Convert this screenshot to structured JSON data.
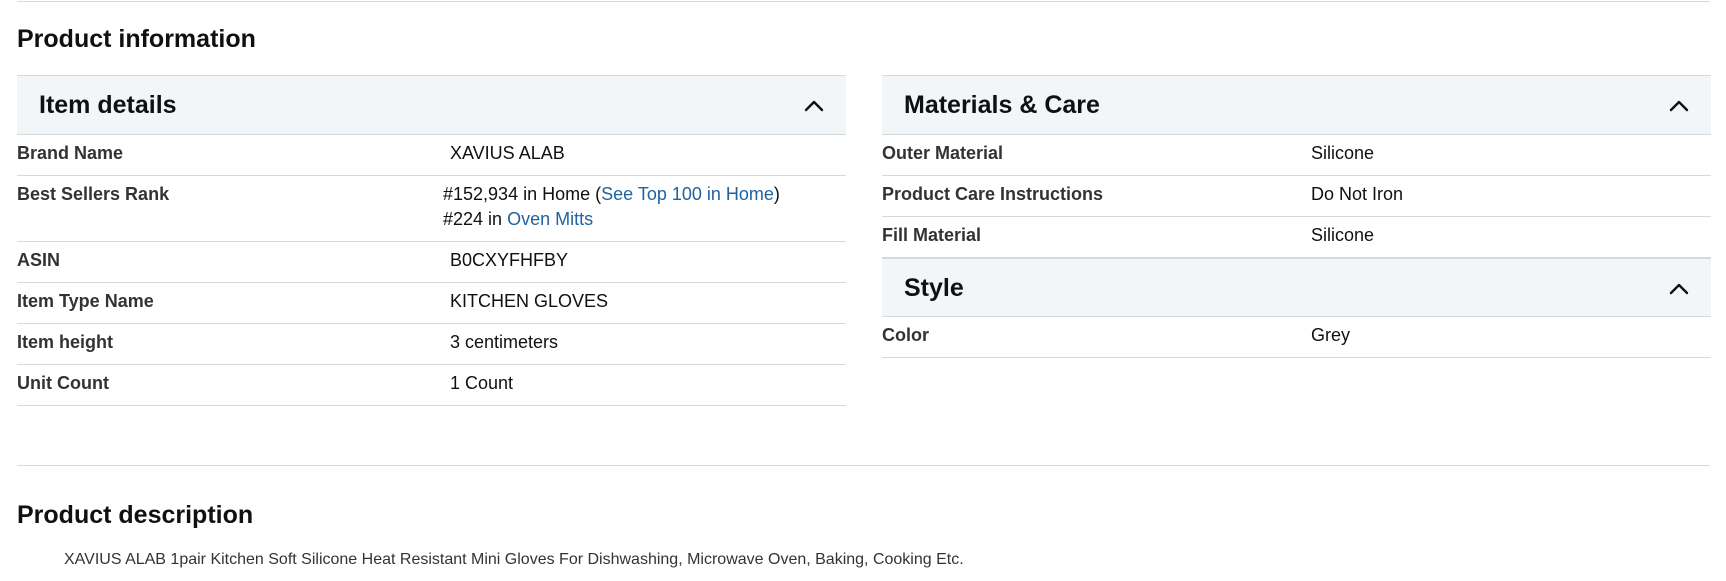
{
  "product_information": {
    "title": "Product information",
    "item_details": {
      "header": "Item details",
      "rows": [
        {
          "key": "Brand Name",
          "value": "XAVIUS ALAB"
        },
        {
          "key": "ASIN",
          "value": "B0CXYFHFBY"
        },
        {
          "key": "Item Type Name",
          "value": "KITCHEN GLOVES"
        },
        {
          "key": "Item height",
          "value": "3 centimeters"
        },
        {
          "key": "Unit Count",
          "value": "1 Count"
        }
      ],
      "best_sellers": {
        "key": "Best Sellers Rank",
        "line1_prefix": "#152,934 in Home (",
        "line1_link": "See Top 100 in Home",
        "line1_suffix": ")",
        "line2_prefix": "#224 in ",
        "line2_link": "Oven Mitts"
      }
    },
    "materials_care": {
      "header": "Materials & Care",
      "rows": [
        {
          "key": "Outer Material",
          "value": "Silicone"
        },
        {
          "key": "Product Care Instructions",
          "value": "Do Not Iron"
        },
        {
          "key": "Fill Material",
          "value": "Silicone"
        }
      ]
    },
    "style": {
      "header": "Style",
      "rows": [
        {
          "key": "Color",
          "value": "Grey"
        }
      ]
    }
  },
  "product_description": {
    "title": "Product description",
    "text": "XAVIUS ALAB 1pair Kitchen Soft Silicone Heat Resistant Mini Gloves For Dishwashing, Microwave Oven, Baking, Cooking Etc."
  },
  "icons": {
    "collapse": "chevron-up-icon"
  },
  "colors": {
    "link": "#2162a1",
    "header_bg": "#f3f6f8",
    "divider": "#d5d9d9"
  }
}
